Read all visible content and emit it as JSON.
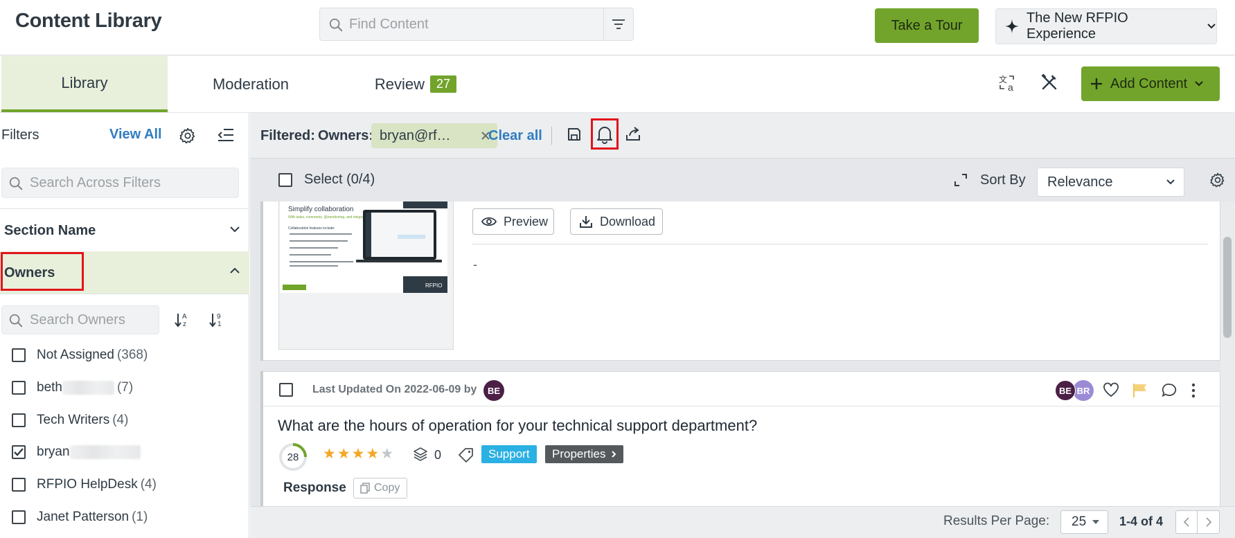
{
  "header": {
    "title": "Content Library",
    "search_placeholder": "Find Content",
    "tour_label": "Take a Tour",
    "experience_label": "The New RFPIO Experience"
  },
  "tabs": [
    {
      "label": "Library",
      "active": true
    },
    {
      "label": "Moderation",
      "active": false
    },
    {
      "label": "Review",
      "badge": "27",
      "active": false
    }
  ],
  "toolbar": {
    "add_content_label": "Add Content",
    "icons": [
      "translate-icon",
      "tools-icon"
    ]
  },
  "sidebar": {
    "filters_label": "Filters",
    "view_all_label": "View All",
    "search_filters_placeholder": "Search Across Filters",
    "section_name_label": "Section Name",
    "owners_label": "Owners",
    "search_owners_placeholder": "Search Owners",
    "owners": [
      {
        "name": "Not Assigned",
        "count": "(368)",
        "checked": false
      },
      {
        "name": "beth",
        "count": "(7)",
        "checked": false,
        "redacted": true
      },
      {
        "name": "Tech Writers",
        "count": "(4)",
        "checked": false
      },
      {
        "name": "bryan",
        "count": "",
        "checked": true,
        "redacted": true
      },
      {
        "name": "RFPIO HelpDesk",
        "count": "(4)",
        "checked": false
      },
      {
        "name": "Janet Patterson",
        "count": "(1)",
        "checked": false
      }
    ]
  },
  "filter_bar": {
    "filtered_label": "Filtered:",
    "owners_label": "Owners:",
    "chip_label": "bryan@rf…",
    "clear_all_label": "Clear all"
  },
  "select_bar": {
    "select_label": "Select (0/4)",
    "sort_by_label": "Sort By",
    "sort_value": "Relevance"
  },
  "card1": {
    "preview_label": "Preview",
    "download_label": "Download",
    "content_text": "-",
    "thumbnail": {
      "heading": "Simplify collaboration",
      "subheading": "With tasks, comments, @mentioning, and integrations",
      "list_title": "Collaboration features include:",
      "brand": "RFPIO"
    }
  },
  "card2": {
    "updated_text": "Last Updated On 2022-06-09 by",
    "author_initials": "BE",
    "owner_avatars": [
      "BE",
      "BR"
    ],
    "question": "What are the hours of operation for your technical support department?",
    "score": "28",
    "rating": 4,
    "rating_max": 5,
    "layers_count": "0",
    "tags": [
      "Support"
    ],
    "properties_label": "Properties",
    "response_label": "Response",
    "copy_label": "Copy"
  },
  "pagination": {
    "results_per_page_label": "Results Per Page:",
    "per_page_value": "25",
    "range_label": "1-4 of 4"
  },
  "colors": {
    "brand_green": "#72a42b",
    "link_blue": "#2f7cc1",
    "highlight_red": "#e3141b",
    "support_tag": "#2bb0e3",
    "star_gold": "#f5a623",
    "avatar_be": "#4b1f46",
    "avatar_br": "#9b8bd6"
  }
}
